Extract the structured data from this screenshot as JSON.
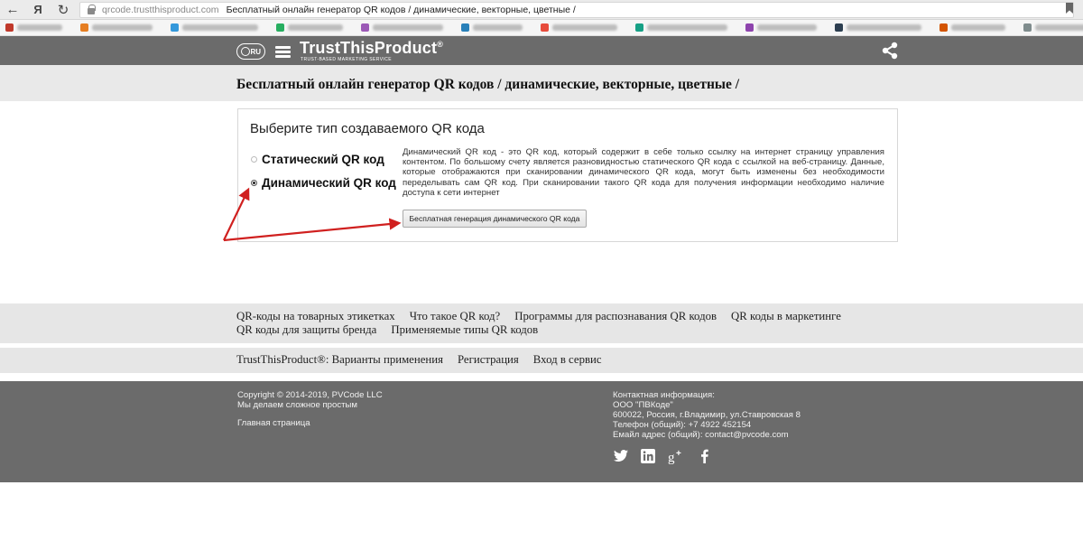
{
  "browser": {
    "back": "←",
    "yandex": "Я",
    "reload": "↻",
    "url_domain": "qrcode.trustthisproduct.com",
    "tab_title": "Бесплатный онлайн генератор QR кодов / динамические, векторные, цветные /",
    "bookmark_icon": "bookmark-icon",
    "bookmark_favicons": [
      "#c0392b",
      "#e67e22",
      "#3498db",
      "#27ae60",
      "#9b59b6",
      "#2980b9",
      "#e74c3c",
      "#16a085",
      "#8e44ad",
      "#2c3e50",
      "#d35400",
      "#7f8c8d"
    ]
  },
  "header": {
    "logo_badge": "RU",
    "logo_text": "TrustThisProduct",
    "logo_reg": "®",
    "logo_sub": "TRUST-BASED MARKETING SERVICE",
    "menu_icon": "hamburger-icon",
    "share_icon": "share-icon"
  },
  "page": {
    "title": "Бесплатный онлайн генератор QR кодов / динамические, векторные, цветные /"
  },
  "panel": {
    "title": "Выберите тип создаваемого QR кода",
    "options": [
      {
        "label": "Статический QR код",
        "checked": false
      },
      {
        "label": "Динамический QR код",
        "checked": true
      }
    ],
    "description": "Динамический QR код - это QR код, который содержит в себе только ссылку на интернет страницу управления контентом. По большому счету является разновидностью статического QR кода с ссылкой на веб-страницу. Данные, которые отображаются при сканировании динамического QR кода, могут быть изменены без необходимости переделывать сам QR код. При сканировании такого QR кода для получения информации необходимо наличие доступа к сети интернет",
    "button_label": "Бесплатная генерация динамического QR кода",
    "accent": "#d0201f"
  },
  "links": {
    "row1": [
      "QR-коды на товарных этикетках",
      "Что такое QR код?",
      "Программы для распознавания QR кодов",
      "QR коды в маркетинге"
    ],
    "row2": [
      "QR коды для защиты бренда",
      "Применяемые типы QR кодов"
    ],
    "row3": [
      "TrustThisProduct®: Варианты применения",
      "Регистрация",
      "Вход в сервис"
    ]
  },
  "footer": {
    "copyright": "Copyright © 2014-2019, PVCode LLC",
    "tagline": "Мы делаем сложное простым",
    "home": "Главная страница",
    "contact_title": "Контактная информация:",
    "company": "ООО \"ПВКоде\"",
    "address": "600022, Россия, г.Владимир, ул.Ставровская 8",
    "phone": "Телефон (общий): +7 4922 452154",
    "email": "Емайл адрес (общий): contact@pvcode.com",
    "social": [
      "twitter-icon",
      "linkedin-icon",
      "google-plus-icon",
      "facebook-icon"
    ]
  }
}
